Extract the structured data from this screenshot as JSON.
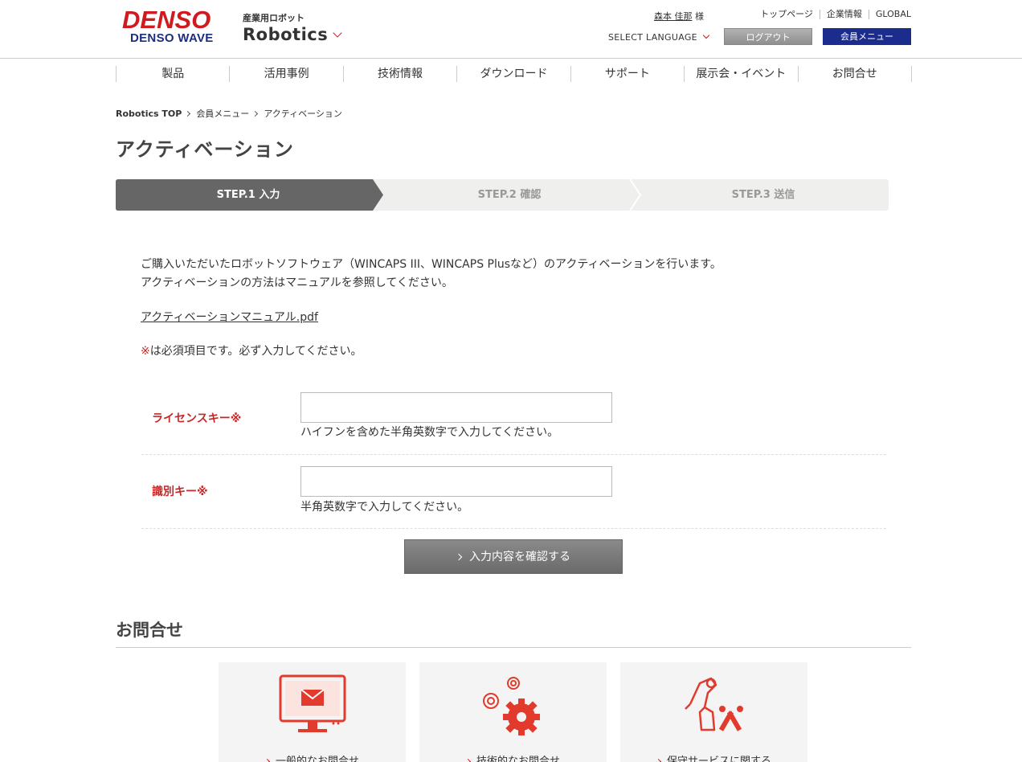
{
  "header": {
    "logo_top": "DENSO",
    "logo_bottom": "DENSO WAVE",
    "site_sub": "産業用ロボット",
    "site_title": "Robotics",
    "user_name": "森本 佳那",
    "user_suffix": " 様",
    "top_links": [
      "トップページ",
      "企業情報",
      "GLOBAL"
    ],
    "language_label": "SELECT LANGUAGE",
    "logout_label": "ログアウト",
    "member_menu_label": "会員メニュー"
  },
  "nav": [
    "製品",
    "活用事例",
    "技術情報",
    "ダウンロード",
    "サポート",
    "展示会・イベント",
    "お問合せ"
  ],
  "breadcrumb": [
    "Robotics TOP",
    "会員メニュー",
    "アクティベーション"
  ],
  "page_title": "アクティベーション",
  "steps": [
    "STEP.1 入力",
    "STEP.2 確認",
    "STEP.3 送信"
  ],
  "intro_lines": [
    "ご購入いただいたロボットソフトウェア（WINCAPS III、WINCAPS Plusなど）のアクティベーションを行います。",
    "アクティベーションの方法はマニュアルを参照してください。"
  ],
  "manual_link": "アクティベーションマニュアル.pdf",
  "required_mark": "※",
  "required_note": "は必須項目です。必ず入力してください。",
  "form": {
    "license_label": "ライセンスキー※",
    "license_value": "",
    "license_hint": "ハイフンを含めた半角英数字で入力してください。",
    "id_label": "識別キー※",
    "id_value": "",
    "id_hint": "半角英数字で入力してください。",
    "confirm_label": "入力内容を確認する"
  },
  "contact": {
    "title": "お問合せ",
    "cards": [
      "一般的なお問合せ",
      "技術的なお問合せ",
      "保守サービスに関する"
    ]
  },
  "colors": {
    "brand_red": "#d11920",
    "brand_blue": "#1d2d80",
    "step_active": "#666666",
    "required_red": "#c62828"
  }
}
